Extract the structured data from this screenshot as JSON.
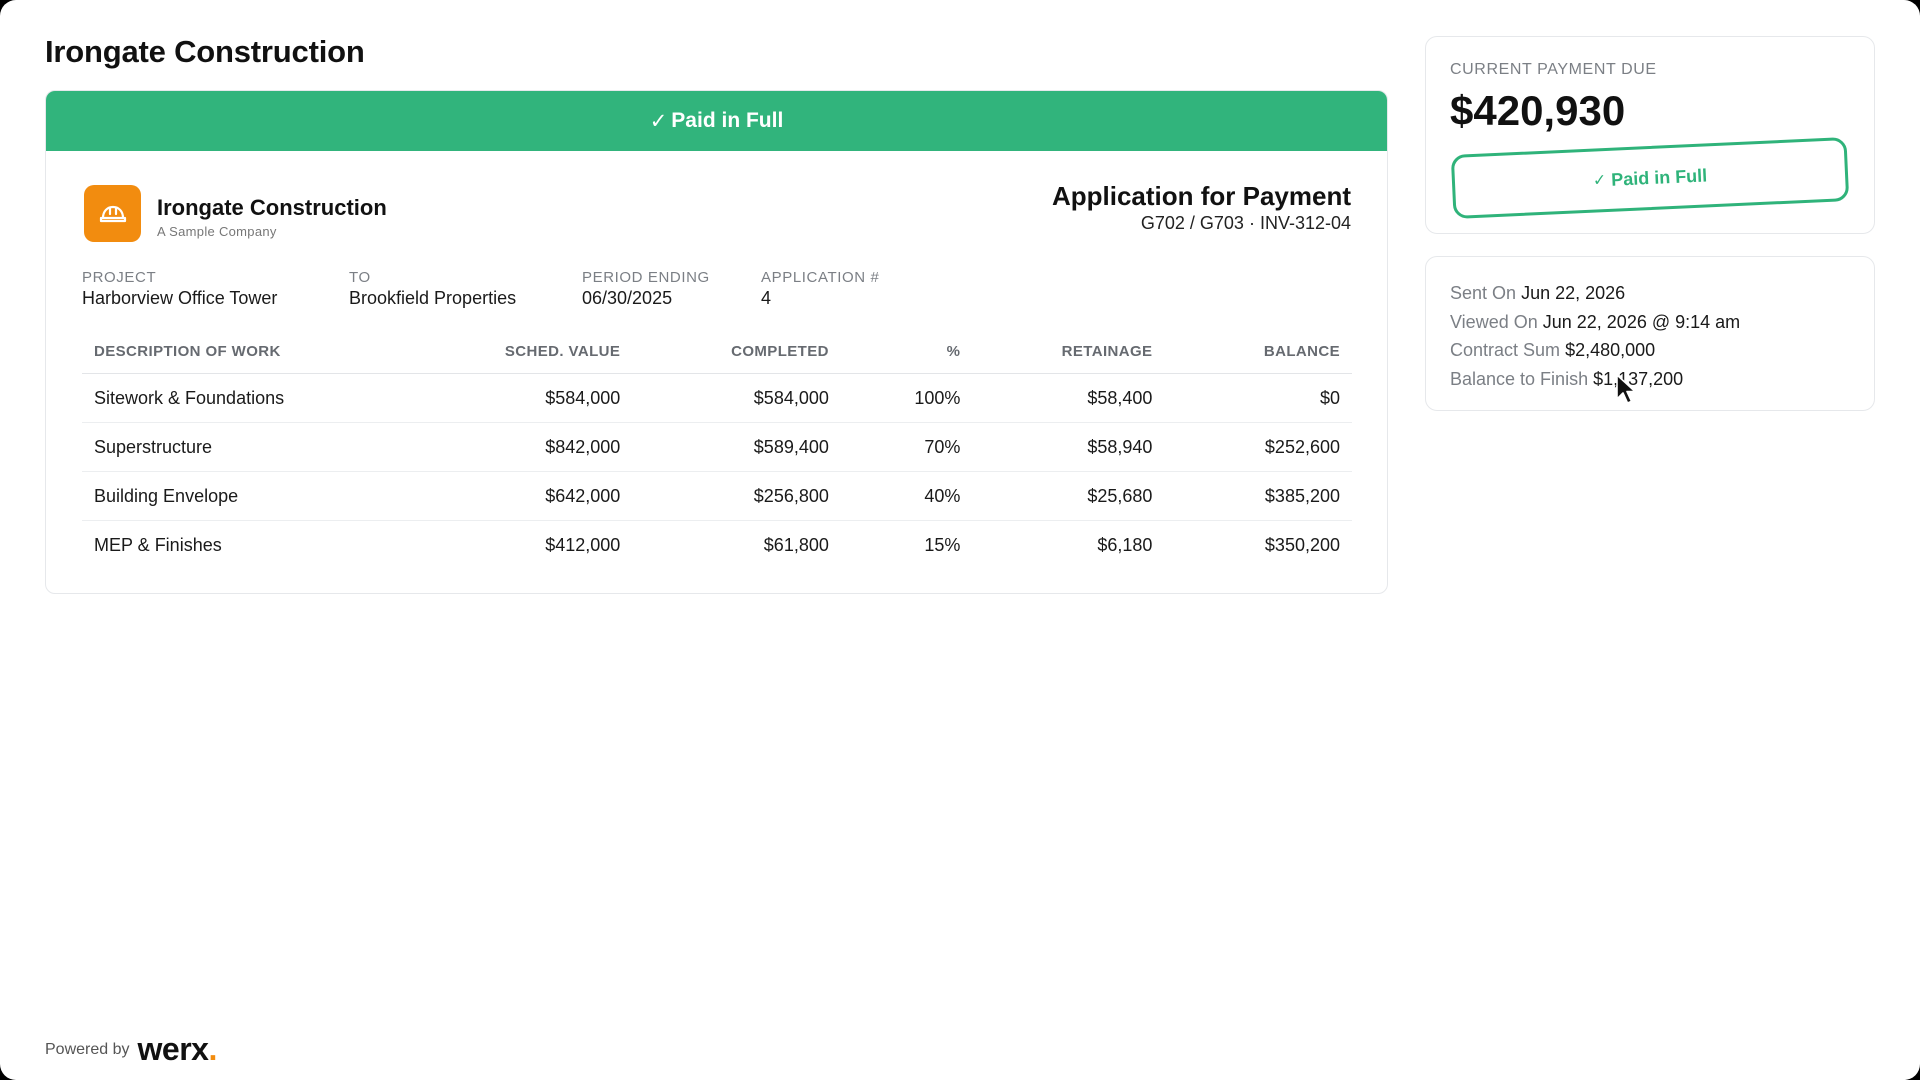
{
  "header": {
    "title": "Irongate Construction"
  },
  "banner": {
    "check": "✓",
    "text": "Paid in Full"
  },
  "company": {
    "name": "Irongate Construction",
    "tagline": "A Sample Company",
    "logo_icon": "hard-hat-icon",
    "brand_color": "#f28c0f"
  },
  "document": {
    "title": "Application for Payment",
    "reference": "G702 / G703 · INV-312-04"
  },
  "meta": [
    {
      "label": "PROJECT",
      "value": "Harborview Office Tower"
    },
    {
      "label": "TO",
      "value": "Brookfield Properties"
    },
    {
      "label": "PERIOD ENDING",
      "value": "06/30/2025"
    },
    {
      "label": "APPLICATION #",
      "value": "4"
    }
  ],
  "table": {
    "headers": [
      "DESCRIPTION OF WORK",
      "SCHED. VALUE",
      "COMPLETED",
      "%",
      "RETAINAGE",
      "BALANCE"
    ],
    "rows": [
      [
        "Sitework & Foundations",
        "$584,000",
        "$584,000",
        "100%",
        "$58,400",
        "$0"
      ],
      [
        "Superstructure",
        "$842,000",
        "$589,400",
        "70%",
        "$58,940",
        "$252,600"
      ],
      [
        "Building Envelope",
        "$642,000",
        "$256,800",
        "40%",
        "$25,680",
        "$385,200"
      ],
      [
        "MEP & Finishes",
        "$412,000",
        "$61,800",
        "15%",
        "$6,180",
        "$350,200"
      ]
    ]
  },
  "payment": {
    "label": "CURRENT PAYMENT DUE",
    "amount": "$420,930",
    "stamp_check": "✓",
    "stamp_text": "Paid in Full",
    "accent": "#2fb37a"
  },
  "info": [
    {
      "label": "Sent On",
      "value": "Jun 22, 2026"
    },
    {
      "label": "Viewed On",
      "value": "Jun 22, 2026 @ 9:14 am"
    },
    {
      "label": "Contract Sum",
      "value": "$2,480,000"
    },
    {
      "label": "Balance to Finish",
      "value": "$1,137,200"
    }
  ],
  "footer": {
    "powered_by": "Powered by",
    "brand": "werx",
    "brand_dot": "."
  }
}
